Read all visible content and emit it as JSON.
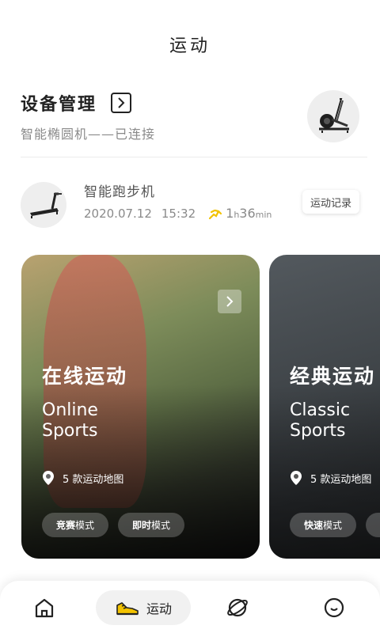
{
  "header": {
    "title": "运动"
  },
  "device": {
    "title": "设备管理",
    "status": "智能椭圆机——已连接",
    "icon": "elliptical-machine-icon"
  },
  "treadmill": {
    "name": "智能跑步机",
    "date": "2020.07.12",
    "time": "15:32",
    "duration_h": "1",
    "duration_h_unit": "h",
    "duration_m": "36",
    "duration_m_unit": "min",
    "record_label": "运动记录",
    "icon": "treadmill-icon"
  },
  "cards": [
    {
      "title_cn": "在线运动",
      "title_en_line1": "Online",
      "title_en_line2": "Sports",
      "maps": "5 款运动地图",
      "modes": [
        {
          "bold": "竞赛",
          "rest": "模式"
        },
        {
          "bold": "即时",
          "rest": "模式"
        }
      ]
    },
    {
      "title_cn": "经典运动",
      "title_en_line1": "Classic",
      "title_en_line2": "Sports",
      "maps": "5 款运动地图",
      "modes": [
        {
          "bold": "快速",
          "rest": "模式"
        }
      ]
    }
  ],
  "nav": {
    "sport_label": "运动",
    "accent": "#f2c200"
  }
}
